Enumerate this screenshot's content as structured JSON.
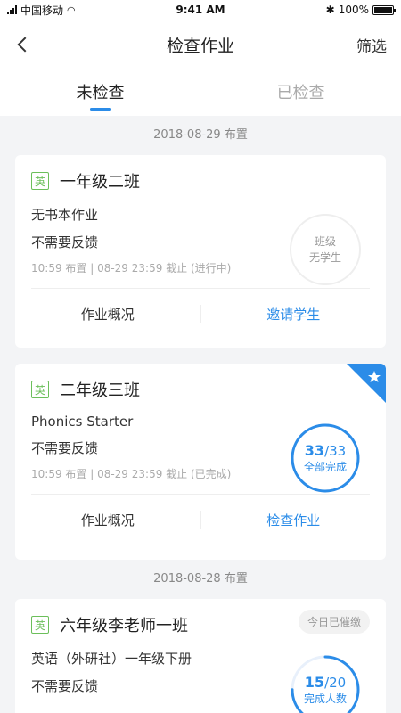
{
  "status_bar": {
    "carrier": "中国移动",
    "time": "9:41 AM",
    "battery": "100%"
  },
  "nav": {
    "title": "检查作业",
    "filter": "筛选"
  },
  "tabs": [
    {
      "label": "未检查",
      "active": true
    },
    {
      "label": "已检查",
      "active": false
    }
  ],
  "groups": [
    {
      "date": "2018-08-29 布置"
    },
    {
      "date": "2018-08-28 布置"
    }
  ],
  "cards": [
    {
      "subject": "英",
      "class_name": "一年级二班",
      "line1": "无书本作业",
      "line2": "不需要反馈",
      "meta": "10:59 布置 | 08-29 23:59 截止 (进行中)",
      "status_line1": "班级",
      "status_line2": "无学生",
      "action_left": "作业概况",
      "action_right": "邀请学生"
    },
    {
      "subject": "英",
      "class_name": "二年级三班",
      "line1": "Phonics Starter",
      "line2": "不需要反馈",
      "meta": "10:59 布置 | 08-29 23:59 截止 (已完成)",
      "done": "33",
      "total": "/33",
      "progress": 1.0,
      "progress_label": "全部完成",
      "action_left": "作业概况",
      "action_right": "检查作业",
      "badge_icon": "star-icon"
    },
    {
      "subject": "英",
      "class_name": "六年级李老师一班",
      "reminded": "今日已催缴",
      "line1": "英语（外研社）一年级下册",
      "line2": "不需要反馈",
      "done": "15",
      "total": "/20",
      "progress": 0.75,
      "progress_label": "完成人数"
    }
  ],
  "colors": {
    "accent": "#2b8ce8",
    "subject_tag": "#6cbf5b"
  }
}
